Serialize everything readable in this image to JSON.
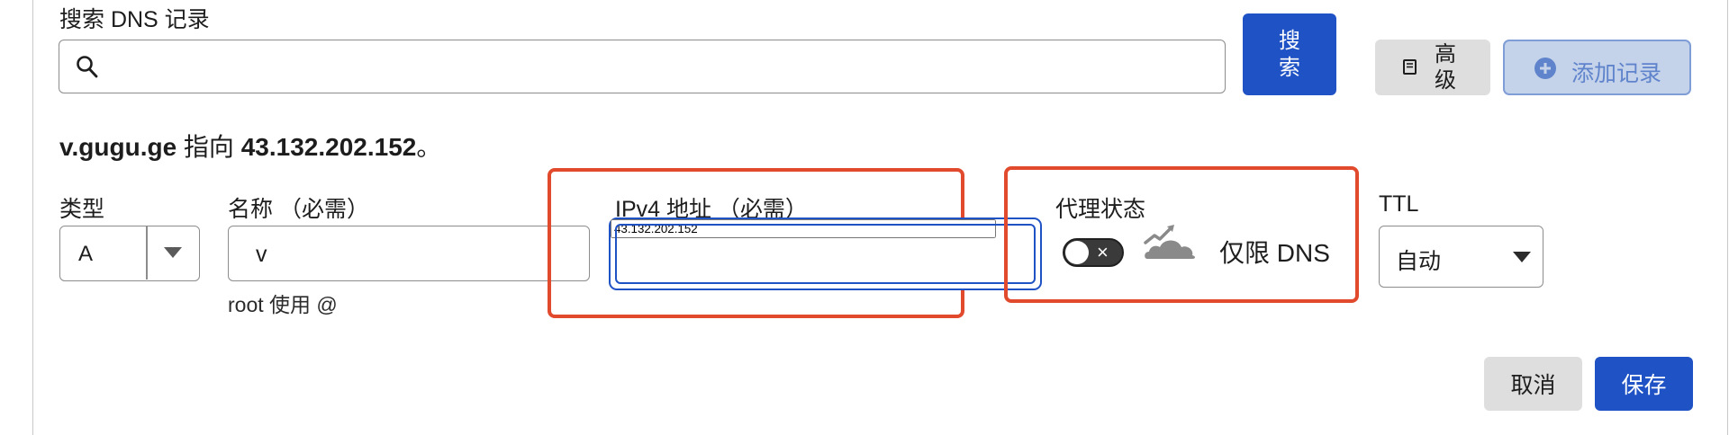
{
  "search": {
    "label": "搜索 DNS 记录",
    "value": "",
    "button_label": "搜索",
    "advanced_label": "高级",
    "add_record_label": "添加记录"
  },
  "record_note": {
    "host": "v.gugu.ge",
    "connector": " 指向 ",
    "target": "43.132.202.152",
    "suffix": "。"
  },
  "form": {
    "type_label": "类型",
    "type_value": "A",
    "name_label": "名称 （必需）",
    "name_value": "v",
    "name_hint": "root 使用 @",
    "ipv4_label": "IPv4 地址 （必需）",
    "ipv4_value": "43.132.202.152",
    "proxy_label": "代理状态",
    "proxy_toggle_mark": "×",
    "proxy_status_text": "仅限 DNS",
    "ttl_label": "TTL",
    "ttl_value": "自动"
  },
  "actions": {
    "cancel_label": "取消",
    "save_label": "保存"
  },
  "colors": {
    "primary": "#1f52c4",
    "highlight_box": "#e24a2e",
    "add_button_bg": "#c5d3ea",
    "cloud_grey": "#8a8a8a"
  },
  "icons": {
    "search": "search-icon",
    "advanced": "document-icon",
    "add": "plus-circle-icon",
    "dropdown": "caret-down-icon",
    "proxy": "cloud-dns-only-icon"
  }
}
